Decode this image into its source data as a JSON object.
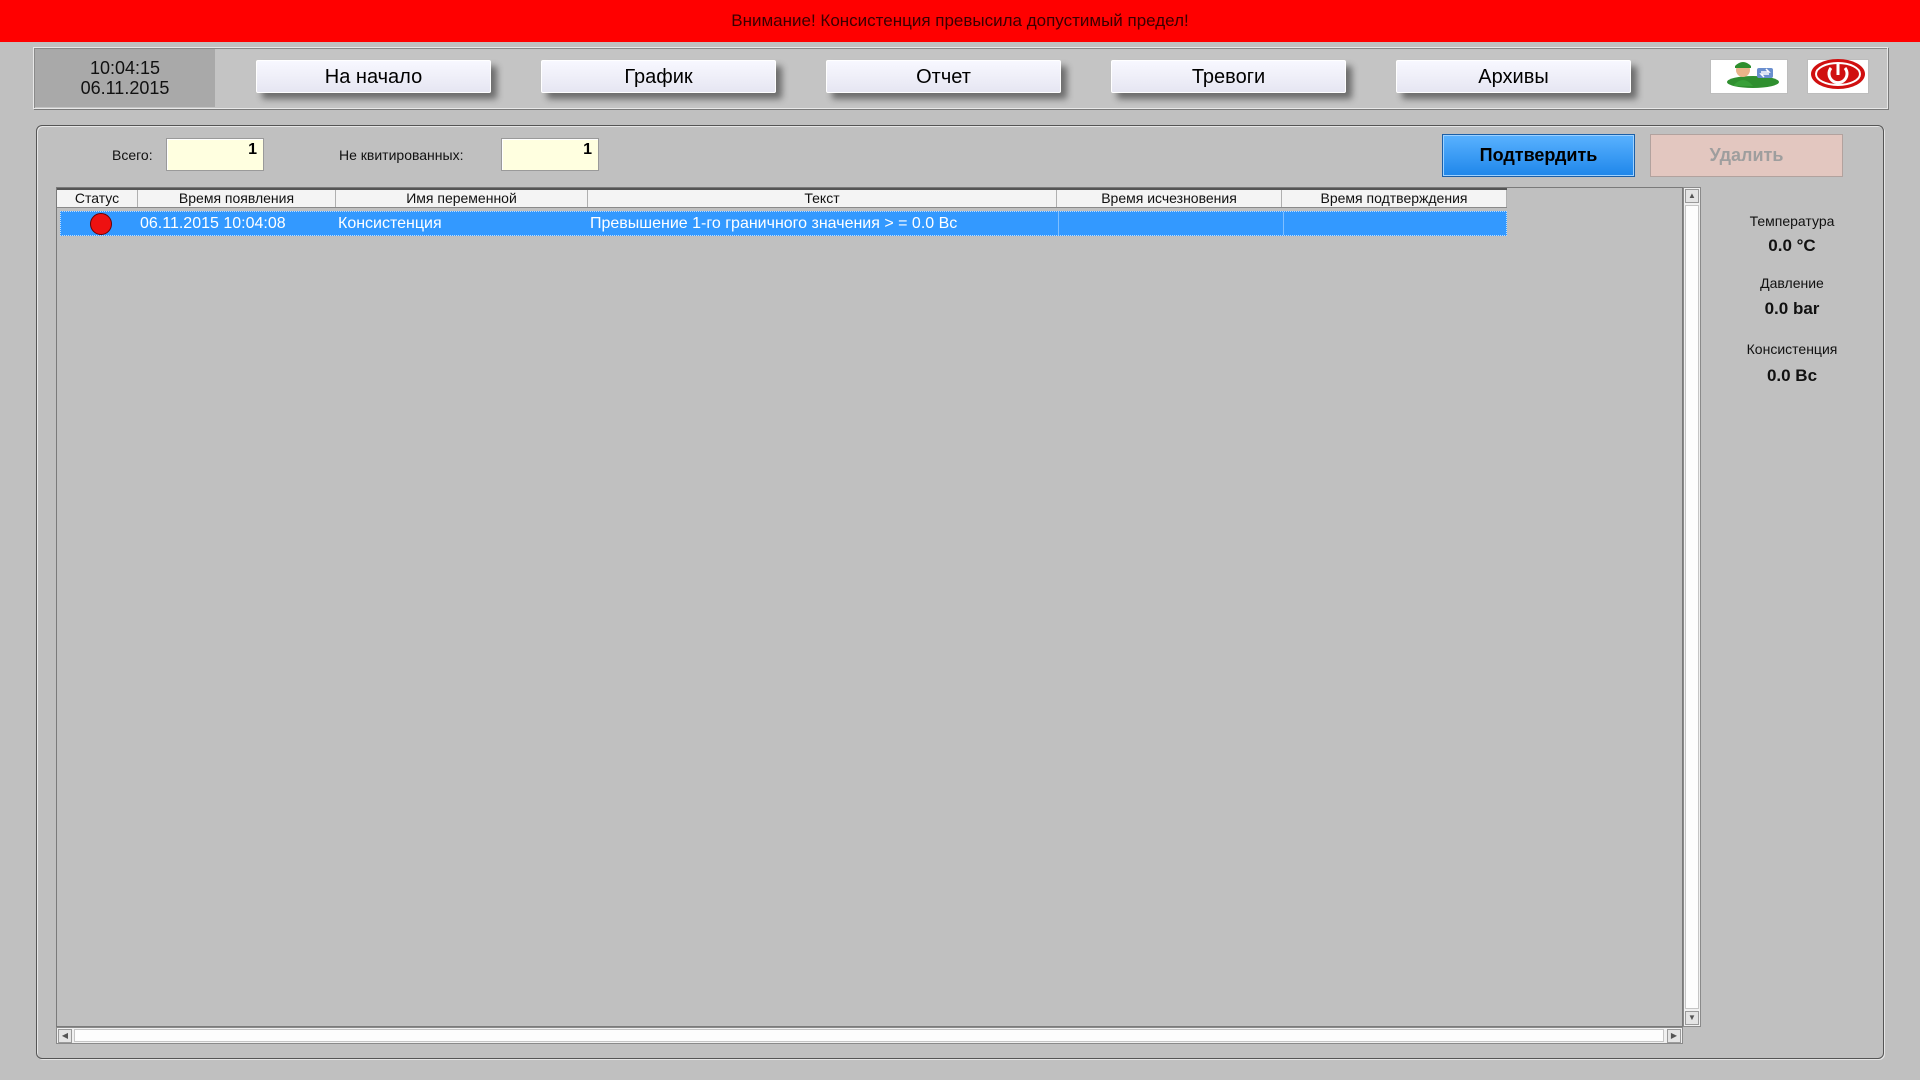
{
  "banner": {
    "text": "Внимание! Консистенция превысила допустимый предел!",
    "color": "#ff0000"
  },
  "header": {
    "time": "10:04:15",
    "date": "06.11.2015",
    "nav": [
      {
        "label": "На начало"
      },
      {
        "label": "График"
      },
      {
        "label": "Отчет"
      },
      {
        "label": "Тревоги"
      },
      {
        "label": "Архивы"
      }
    ],
    "icons": {
      "user": "user-switch-icon",
      "power": "power-icon"
    }
  },
  "counters": {
    "total_label": "Всего:",
    "total_value": "1",
    "unack_label": "Не квитированных:",
    "unack_value": "1"
  },
  "actions": {
    "confirm_label": "Подтвердить",
    "confirm_color": "#1e86ea",
    "delete_label": "Удалить"
  },
  "table": {
    "columns": [
      "Статус",
      "Время появления",
      "Имя переменной",
      "Текст",
      "Время исчезновения",
      "Время подтверждения"
    ],
    "rows": [
      {
        "status": "alarm",
        "status_color": "#ee1111",
        "appeared": "06.11.2015 10:04:08",
        "variable": "Консистенция",
        "text": "Превышение 1-го граничного значения > = 0.0 Вс",
        "disappeared": "",
        "confirmed": ""
      }
    ],
    "selected_row_color": "#3399ff"
  },
  "sidebar": {
    "readings": [
      {
        "label": "Температура",
        "value": "0.0 °C"
      },
      {
        "label": "Давление",
        "value": "0.0 bar"
      },
      {
        "label": "Консистенция",
        "value": "0.0 Вс"
      }
    ]
  }
}
